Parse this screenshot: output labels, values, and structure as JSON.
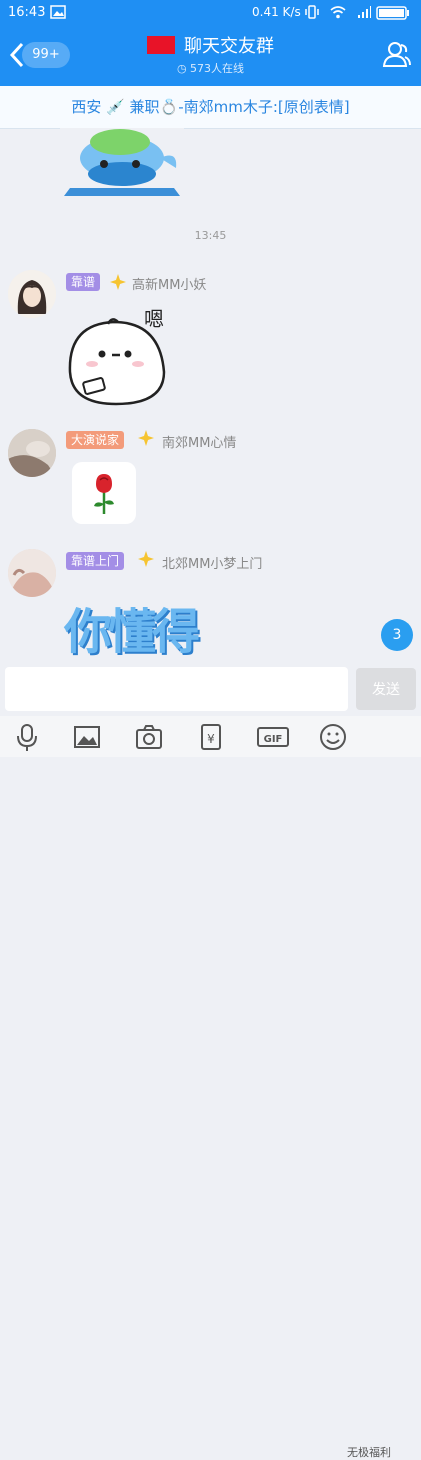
{
  "status_bar": {
    "time": "16:43",
    "speed": "0.41 K/s"
  },
  "header": {
    "unread_count": "99+",
    "title": "聊天交友群",
    "online": "573人在线"
  },
  "notice": {
    "text": "西安 💉 兼职💍-南郊mm木子:[原创表情]"
  },
  "chat": {
    "timestamp": "13:45",
    "messages": [
      {
        "rank": "靠谱",
        "rank_color": "#a38ee6",
        "nick": "高新MM小妖",
        "content_icon": "mochi-sticker-icon"
      },
      {
        "rank": "大演说家",
        "rank_color": "#f39b7a",
        "nick": "南郊MM心情",
        "content_icon": "rose-icon"
      },
      {
        "rank": "靠谱上门",
        "rank_color": "#a38ee6",
        "nick": "北郊MM小梦上门",
        "content_text": "你懂得"
      }
    ]
  },
  "unread_bubble": "3",
  "input": {
    "value": "",
    "send_label": "发送"
  },
  "toolbar": {
    "icons": [
      "microphone-icon",
      "image-icon",
      "camera-icon",
      "red-packet-icon",
      "gif-icon",
      "emoji-icon"
    ]
  },
  "watermark": "无极福利",
  "colors": {
    "primary": "#1f8ff3",
    "notice_text": "#2a86e0",
    "background": "#eef0f5"
  }
}
